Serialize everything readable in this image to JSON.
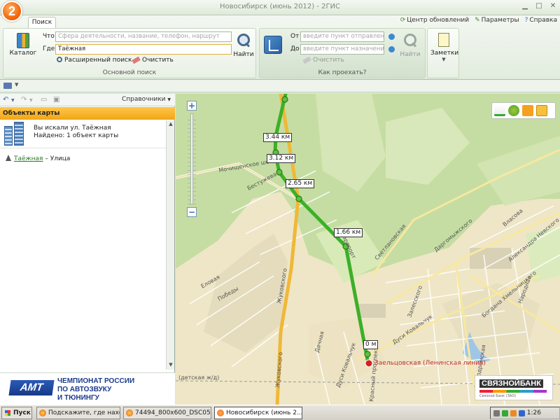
{
  "window": {
    "title": "Новосибирск (июнь 2012) - 2ГИС"
  },
  "tabs": {
    "search": "Поиск"
  },
  "top_links": {
    "updates": "Центр обновлений",
    "settings": "Параметры",
    "help": "Справка"
  },
  "search_group": {
    "catalog_label": "Каталог",
    "what_label": "Что",
    "what_placeholder": "Сфера деятельности, название, телефон, наршрут",
    "where_label": "Где",
    "where_value": "Таёжная",
    "find_label": "Найти",
    "advanced_label": "Расширенный поиск",
    "clear_label": "Очистить",
    "group_label": "Основной поиск"
  },
  "route_group": {
    "from_label": "От",
    "from_placeholder": "введите пункт отправления",
    "to_label": "До",
    "to_placeholder": "введите пункт назначения",
    "find_label": "Найти",
    "clear_label": "Очистить",
    "group_label": "Как проехать?"
  },
  "notes_group": {
    "label": "Заметки"
  },
  "left_panel": {
    "reference_label": "Справочники",
    "header": "Объекты карты",
    "searched_for": "Вы искали ул. Таёжная",
    "found": "Найдено: 1 объект карты",
    "result_name": "Таёжная",
    "result_type": "– Улица"
  },
  "ad": {
    "brand": "АМТ",
    "line1": "ЧЕМПИОНАТ РОССИИ",
    "line2": "ПО АВТОЗВУКУ",
    "line3": "И ТЮНИНГУ"
  },
  "map": {
    "distances": [
      "3.44 км",
      "3.12 км",
      "2.65 км",
      "1.66 км",
      "0 м"
    ],
    "station": "Заельцовская (Ленинская линия)",
    "streets": {
      "highway": "Мочищенское шоссе",
      "bestuzheva": "Бестужева",
      "zhukovskogo1": "Жуковского",
      "zhukovskogo2": "Жуковского",
      "elovaya": "Еловая",
      "pobedy": "Победы",
      "svetlanovskaya": "Светлановская",
      "dargomyzhskogo": "Даргомыжского",
      "vlasova": "Власова",
      "aleksandra_nevskogo": "Александра Невского",
      "narodnaya": "Народная",
      "bogdana": "Богдана Хмельницкого",
      "zalesskogo": "Залесского",
      "dusi_kov1": "Дуси Ковальчук",
      "dusi_kov2": "Дуси Ковальчук",
      "dachnaya": "Дачная",
      "detskaya": "(детская ж/д)",
      "krasny": "Красный проспект",
      "ippodr": "Ипподромская",
      "aerodrom": "Аэропорт"
    },
    "bank": {
      "name": "СВЯЗНОЙБАНК",
      "sub": "Связной Банк (ЗАО)"
    }
  },
  "taskbar": {
    "start": "Пуск",
    "tasks": [
      "Подскажите, где нахо...",
      "74494_800x600_DSC05...",
      "Новосибирск (июнь 2..."
    ],
    "clock": "1:26"
  },
  "colors": {
    "route": "#3cb028",
    "accent_orange": "#f2a514",
    "main_road": "#f0b838",
    "water": "#9fc6e6"
  }
}
